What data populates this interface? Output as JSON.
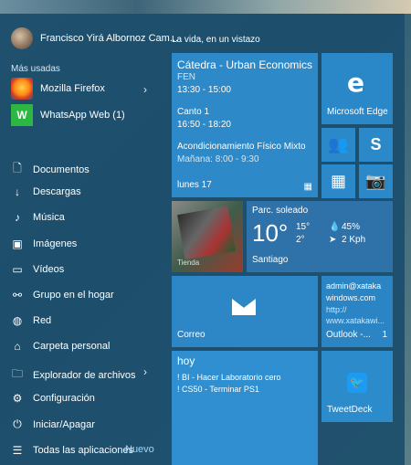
{
  "user": {
    "name": "Francisco Yirá Albornoz Cam..."
  },
  "start_heading": "La vida, en un vistazo",
  "most_used_label": "Más usadas",
  "apps": [
    {
      "name": "Mozilla Firefox",
      "icon": "firefox-icon"
    },
    {
      "name": "WhatsApp Web (1)",
      "icon": "whatsapp-icon"
    }
  ],
  "menu": [
    {
      "label": "Documentos",
      "icon": "document-icon"
    },
    {
      "label": "Descargas",
      "icon": "download-icon"
    },
    {
      "label": "Música",
      "icon": "music-icon"
    },
    {
      "label": "Imágenes",
      "icon": "image-icon"
    },
    {
      "label": "Vídeos",
      "icon": "video-icon"
    },
    {
      "label": "Grupo en el hogar",
      "icon": "homegroup-icon"
    },
    {
      "label": "Red",
      "icon": "network-icon"
    },
    {
      "label": "Carpeta personal",
      "icon": "user-folder-icon"
    },
    {
      "label": "Explorador de archivos",
      "icon": "file-explorer-icon"
    },
    {
      "label": "Configuración",
      "icon": "settings-icon"
    },
    {
      "label": "Iniciar/Apagar",
      "icon": "power-icon"
    },
    {
      "label": "Todas las aplicaciones",
      "icon": "all-apps-icon"
    }
  ],
  "new_badge": "Nuevo",
  "calendar": {
    "title": "Cátedra - Urban Economics",
    "e1_a": "FEN",
    "e1_b": "13:30 - 15:00",
    "e2_a": "Canto 1",
    "e2_b": "16:50 - 18:20",
    "e3_a": "Acondicionamiento Físico Mixto",
    "e3_b": "Mañana: 8:00 - 9:30",
    "day": "lunes 17"
  },
  "edge": {
    "label": "Microsoft Edge",
    "icon": "edge-icon"
  },
  "weather": {
    "condition": "Parc. soleado",
    "temp": "10°",
    "hi": "15°",
    "lo": "2°",
    "humidity": "45%",
    "wind": "2 Kph",
    "city": "Santiago"
  },
  "photos_tile": {
    "text1": "Tienda"
  },
  "mail": {
    "label": "Correo"
  },
  "outlook": {
    "line1": "admin@xataka",
    "line2": "windows.com",
    "line3": "http://",
    "line4": "www.xatakawi...",
    "label": "Outlook -...",
    "count": "1"
  },
  "todo": {
    "title": "hoy",
    "line1": "! BI - Hacer Laboratorio cero",
    "line2": "! CS50 - Terminar PS1"
  },
  "tweetdeck": {
    "label": "TweetDeck"
  }
}
